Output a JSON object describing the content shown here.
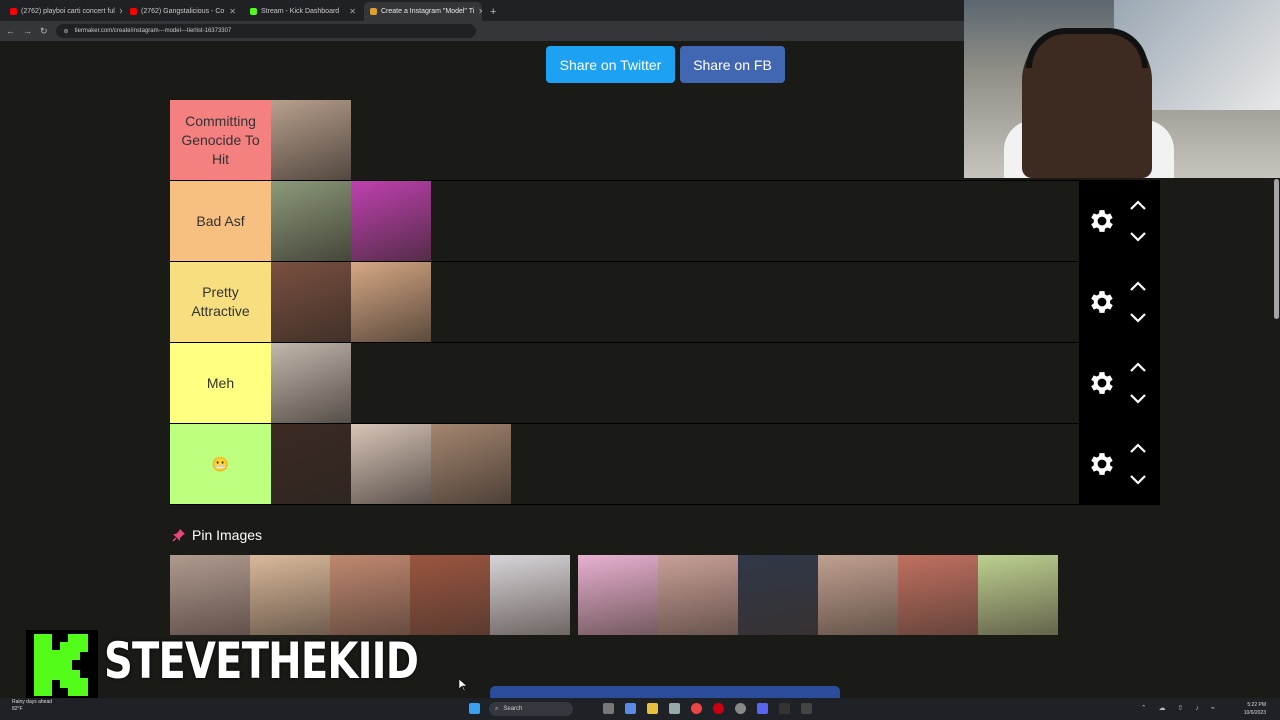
{
  "browser": {
    "tabs": [
      {
        "label": "(2762) playboi carti concert ful",
        "favicon_color": "#ff0000",
        "active": false
      },
      {
        "label": "(2762) Gangstalicious - Co",
        "favicon_color": "#ff0000",
        "active": false
      },
      {
        "label": "Stream - Kick Dashboard",
        "favicon_color": "#53fc18",
        "active": false
      },
      {
        "label": "Create a Instagram \"Model\" Ti",
        "favicon_color": "#e0a030",
        "active": true
      }
    ],
    "new_tab": "+",
    "url": "tiermaker.com/create/instagram---model---tierlist-16373307"
  },
  "share": {
    "twitter_label": "Share on Twitter",
    "fb_label": "Share on FB"
  },
  "tiers": [
    {
      "label": "Committing Genocide To Hit",
      "color": "#f48080",
      "items": [
        "#b8a08e"
      ]
    },
    {
      "label": "Bad Asf",
      "color": "#f7bf80",
      "items": [
        "#8c9a7a",
        "#c040b0"
      ]
    },
    {
      "label": "Pretty Attractive",
      "color": "#f7df80",
      "items": [
        "#7a5040",
        "#d6a884"
      ]
    },
    {
      "label": "Meh",
      "color": "#fefe80",
      "items": [
        "#c2b8ad"
      ]
    },
    {
      "label": "😬",
      "color": "#bfff80",
      "items": [
        "#3b2a22",
        "#d8c5b8",
        "#a58670"
      ]
    }
  ],
  "pin": {
    "icon": "pushpin-icon",
    "label": "Pin Images",
    "images": [
      "#b09a90",
      "#d9b99a",
      "#c08870",
      "#9b5540",
      "#d8d4d8",
      "#e8b0d0",
      "#c8a098",
      "#303848",
      "#c0a090",
      "#c07060",
      "#bcd090"
    ]
  },
  "overlay": {
    "streamer_name": "STEVETHEKIID"
  },
  "taskbar": {
    "weather_line1": "Rainy days ahead",
    "weather_line2": "82°F",
    "search_label": "Search",
    "time": "5:22 PM",
    "date": "10/6/2023"
  }
}
